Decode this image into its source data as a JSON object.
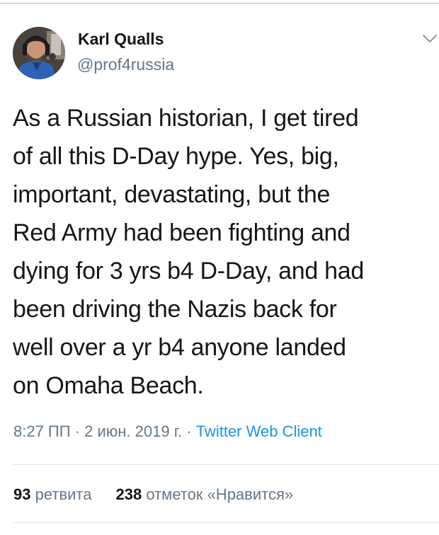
{
  "tweet": {
    "author": {
      "name": "Karl Qualls",
      "handle": "@prof4russia"
    },
    "text_lines": [
      "As a Russian historian, I get tired",
      "of all this D-Day hype. Yes, big,",
      "important, devastating, but the",
      "Red Army had been fighting and",
      "dying for 3 yrs b4 D-Day, and had",
      "been driving the Nazis back for",
      "well over a yr b4 anyone landed",
      "on Omaha Beach."
    ],
    "time": "8:27 ПП",
    "separator": " · ",
    "date": "2 июн. 2019 г.",
    "client": "Twitter Web Client",
    "retweets_count": "93",
    "retweets_label": "ретвита",
    "likes_count": "238",
    "likes_label": "отметок «Нравится»"
  },
  "icons": {
    "avatar": "avatar-photo",
    "menu": "chevron-down-icon"
  },
  "colors": {
    "text": "#14171a",
    "secondary": "#657786",
    "link": "#1b95e0",
    "divider": "#e1e8ed"
  }
}
